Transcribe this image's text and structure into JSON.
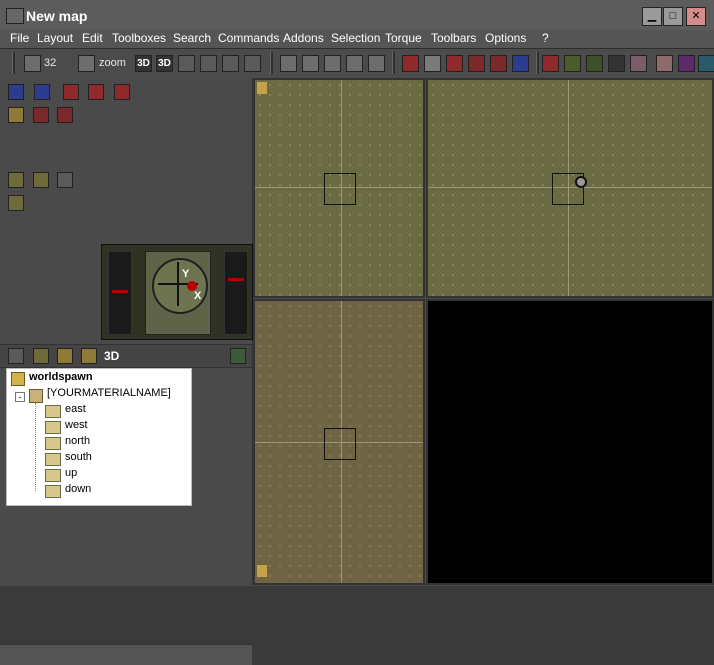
{
  "window": {
    "title": "New map"
  },
  "controls": {
    "minimize": "▁",
    "maximize": "□",
    "close": "✕"
  },
  "menubar": {
    "items": [
      "File",
      "Layout",
      "Edit",
      "Toolboxes",
      "Search",
      "Commands",
      "Addons",
      "Selection",
      "Torque",
      "Toolbars",
      "Options",
      "?"
    ]
  },
  "toolbar": {
    "grid_value": "32",
    "zoom_label": "zoom",
    "btn_3d_a": "3D",
    "btn_3d_b": "3D"
  },
  "compass": {
    "y_label": "Y",
    "x_label": "X"
  },
  "modebar": {
    "btn_3d": "3D"
  },
  "tree": {
    "root": "worldspawn",
    "material": "[YOURMATERIALNAME]",
    "children": [
      "east",
      "west",
      "north",
      "south",
      "up",
      "down"
    ]
  }
}
